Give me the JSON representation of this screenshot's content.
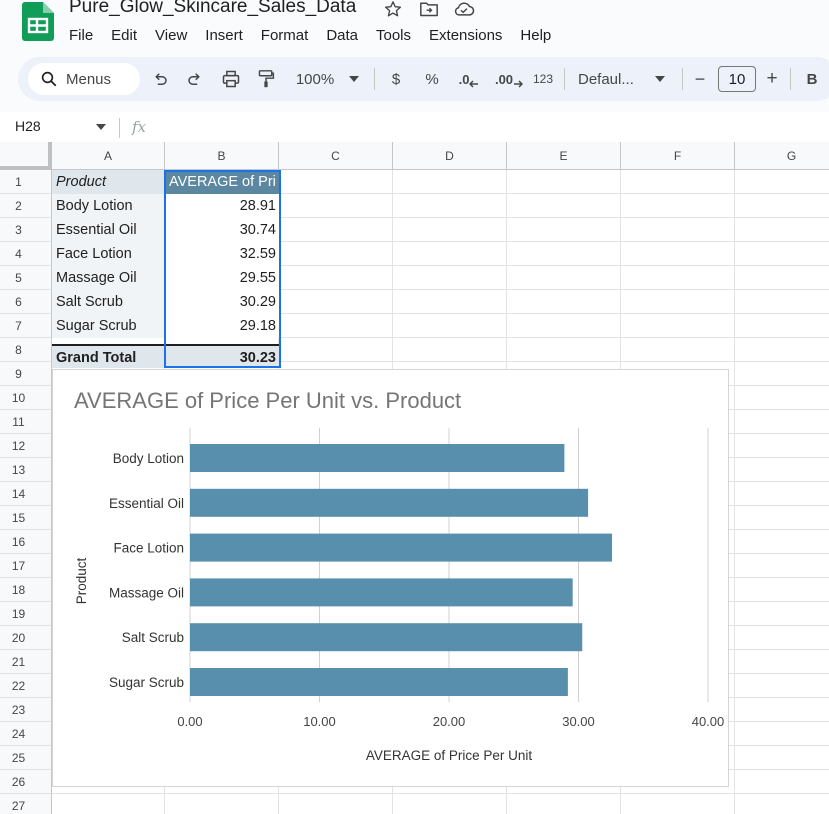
{
  "app": {
    "doc_title": "Pure_Glow_Skincare_Sales_Data",
    "menu": [
      "File",
      "Edit",
      "View",
      "Insert",
      "Format",
      "Data",
      "Tools",
      "Extensions",
      "Help"
    ]
  },
  "toolbar": {
    "search_label": "Menus",
    "zoom": "100%",
    "currency": "$",
    "percent": "%",
    "decrease_decimal": ".0",
    "increase_decimal": ".00",
    "number_format": "123",
    "font": "Defaul...",
    "minus": "−",
    "font_size": "10",
    "plus": "+",
    "bold": "B"
  },
  "formula_bar": {
    "name_box": "H28",
    "fx": "fx"
  },
  "grid": {
    "columns": [
      "A",
      "B",
      "C",
      "D",
      "E",
      "F",
      "G"
    ],
    "rows": [
      "1",
      "2",
      "3",
      "4",
      "5",
      "6",
      "7",
      "8",
      "9",
      "10",
      "11",
      "12",
      "13",
      "14",
      "15",
      "16",
      "17",
      "18",
      "19",
      "20",
      "21",
      "22",
      "23",
      "24",
      "25",
      "26",
      "27"
    ]
  },
  "pivot": {
    "header_product": "Product",
    "header_avg": "AVERAGE of Pri",
    "rows": [
      {
        "product": "Body Lotion",
        "avg": "28.91"
      },
      {
        "product": "Essential Oil",
        "avg": "30.74"
      },
      {
        "product": "Face Lotion",
        "avg": "32.59"
      },
      {
        "product": "Massage Oil",
        "avg": "29.55"
      },
      {
        "product": "Salt Scrub",
        "avg": "30.29"
      },
      {
        "product": "Sugar Scrub",
        "avg": "29.18"
      }
    ],
    "grand_total_label": "Grand Total",
    "grand_total_value": "30.23"
  },
  "colors": {
    "bar": "#588fad",
    "header_fill": "#5b87a0",
    "selection": "#1a73e8",
    "sheets_green": "#0f9d58"
  },
  "chart_data": {
    "type": "bar",
    "orientation": "horizontal",
    "title": "AVERAGE of Price Per Unit vs. Product",
    "xlabel": "AVERAGE of Price Per Unit",
    "ylabel": "Product",
    "categories": [
      "Body Lotion",
      "Essential Oil",
      "Face Lotion",
      "Massage Oil",
      "Salt Scrub",
      "Sugar Scrub"
    ],
    "values": [
      28.91,
      30.74,
      32.59,
      29.55,
      30.29,
      29.18
    ],
    "xlim": [
      0,
      40
    ],
    "xticks": [
      "0.00",
      "10.00",
      "20.00",
      "30.00",
      "40.00"
    ],
    "grid": true,
    "legend": "none"
  }
}
